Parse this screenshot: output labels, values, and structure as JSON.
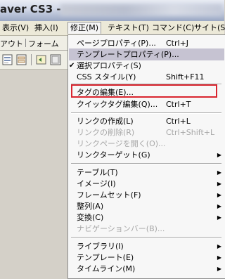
{
  "window": {
    "title": "aver CS3 -"
  },
  "menubar": {
    "items": [
      {
        "label": "表示(V)"
      },
      {
        "label": "挿入(I)"
      },
      {
        "label": "修正(M)"
      },
      {
        "label": "テキスト(T)"
      },
      {
        "label": "コマンド(C)"
      },
      {
        "label": "サイト(S)"
      }
    ]
  },
  "tabs": [
    {
      "label": "アウト"
    },
    {
      "label": "フォーム"
    }
  ],
  "menu": {
    "items": [
      {
        "label": "ページプロパティ(P)...",
        "shortcut": "Ctrl+J"
      },
      {
        "label": "テンプレートプロパティ(P)...",
        "shortcut": ""
      },
      {
        "label": "選択プロパティ(S)",
        "shortcut": ""
      },
      {
        "label": "CSS スタイル(Y)",
        "shortcut": "Shift+F11"
      },
      {
        "label": "タグの編集(E)...",
        "shortcut": ""
      },
      {
        "label": "クイックタグ編集(Q)...",
        "shortcut": "Ctrl+T"
      },
      {
        "label": "リンクの作成(L)",
        "shortcut": "Ctrl+L"
      },
      {
        "label": "リンクの削除(R)",
        "shortcut": "Ctrl+Shift+L"
      },
      {
        "label": "リンクページを開く(O)...",
        "shortcut": ""
      },
      {
        "label": "リンクターゲット(G)",
        "shortcut": ""
      },
      {
        "label": "テーブル(T)",
        "shortcut": ""
      },
      {
        "label": "イメージ(I)",
        "shortcut": ""
      },
      {
        "label": "フレームセット(F)",
        "shortcut": ""
      },
      {
        "label": "整列(A)",
        "shortcut": ""
      },
      {
        "label": "変換(C)",
        "shortcut": ""
      },
      {
        "label": "ナビゲーションバー(B)...",
        "shortcut": ""
      },
      {
        "label": "ライブラリ(I)",
        "shortcut": ""
      },
      {
        "label": "テンプレート(E)",
        "shortcut": ""
      },
      {
        "label": "タイムライン(M)",
        "shortcut": ""
      }
    ]
  },
  "colors": {
    "highlight_box": "#d9252f",
    "menu_highlight": "#c6c3d2",
    "disabled_text": "#a7a7a7"
  }
}
